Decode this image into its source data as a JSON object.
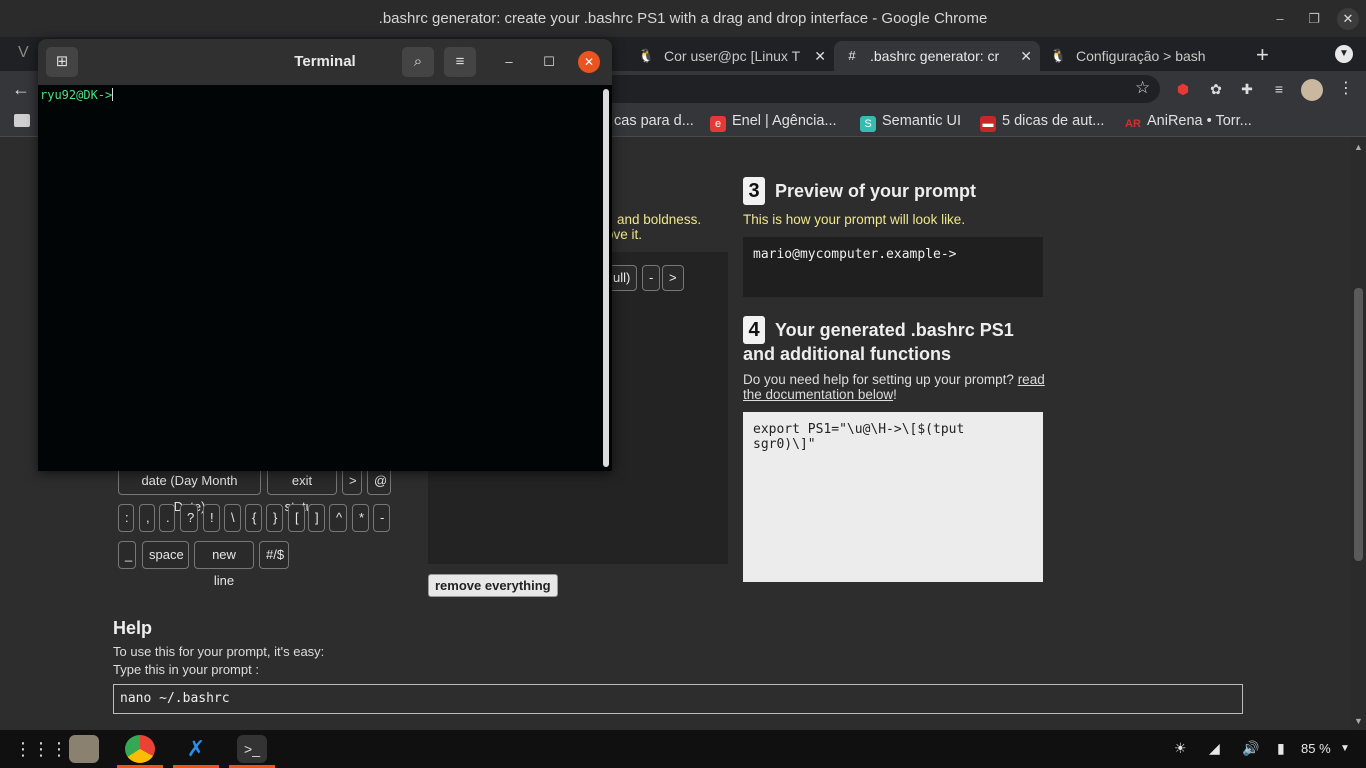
{
  "chrome": {
    "window_title": ".bashrc generator: create your .bashrc PS1 with a drag and drop interface - Google Chrome",
    "tabs": [
      {
        "label": "Cor user@pc [Linux T",
        "icon": "tux-icon"
      },
      {
        "label": ".bashrc generator: cr",
        "icon": "bashrc-favicon"
      },
      {
        "label": "Configuração > bash",
        "icon": "tux-icon"
      }
    ],
    "new_tab": "+",
    "bookmarks": [
      {
        "label": "cas para d...",
        "color": "#35363a"
      },
      {
        "label": "Enel | Agência...",
        "color": "#e53935"
      },
      {
        "label": "Semantic UI",
        "color": "#35bdb2"
      },
      {
        "label": "5 dicas de aut...",
        "color": "#c62828"
      },
      {
        "label": "AniRena • Torr...",
        "color": "#d32f2f"
      }
    ]
  },
  "terminal": {
    "title": "Terminal",
    "prompt": "ryu92@DK->"
  },
  "page": {
    "step2_hint_line1": "and boldness.",
    "step2_hint_line2": "ove it.",
    "dropzone_chips": [
      "ull)",
      "-",
      ">"
    ],
    "step3": {
      "number": "3",
      "title": "Preview of your prompt",
      "subtitle": "This is how your prompt will look like.",
      "preview": "mario@mycomputer.example->"
    },
    "step4": {
      "number": "4",
      "title_line1": "Your generated .bashrc PS1",
      "title_line2": "and additional functions",
      "help_text": "Do you need help for setting up your prompt?",
      "help_link_1": "read",
      "help_link_2": "the documentation below",
      "help_suffix": "!",
      "code": "export PS1=\"\\u@\\H->\\[$(tput\nsgr0)\\]\""
    },
    "elements": {
      "row1": [
        "date (Day Month Date)",
        "exit status",
        ">",
        "@"
      ],
      "row2": [
        ":",
        ",",
        ".",
        "?",
        "!",
        "\\",
        "{",
        "}",
        "[",
        "]",
        "^",
        "*",
        "-"
      ],
      "row3": [
        "_",
        "space",
        "new line",
        "#/$"
      ]
    },
    "remove_button": "remove everything",
    "help": {
      "title": "Help",
      "line1": "To use this for your prompt, it's easy:",
      "line2": "Type this in your prompt :",
      "code": "nano ~/.bashrc"
    }
  },
  "taskbar": {
    "battery": "85 %"
  }
}
